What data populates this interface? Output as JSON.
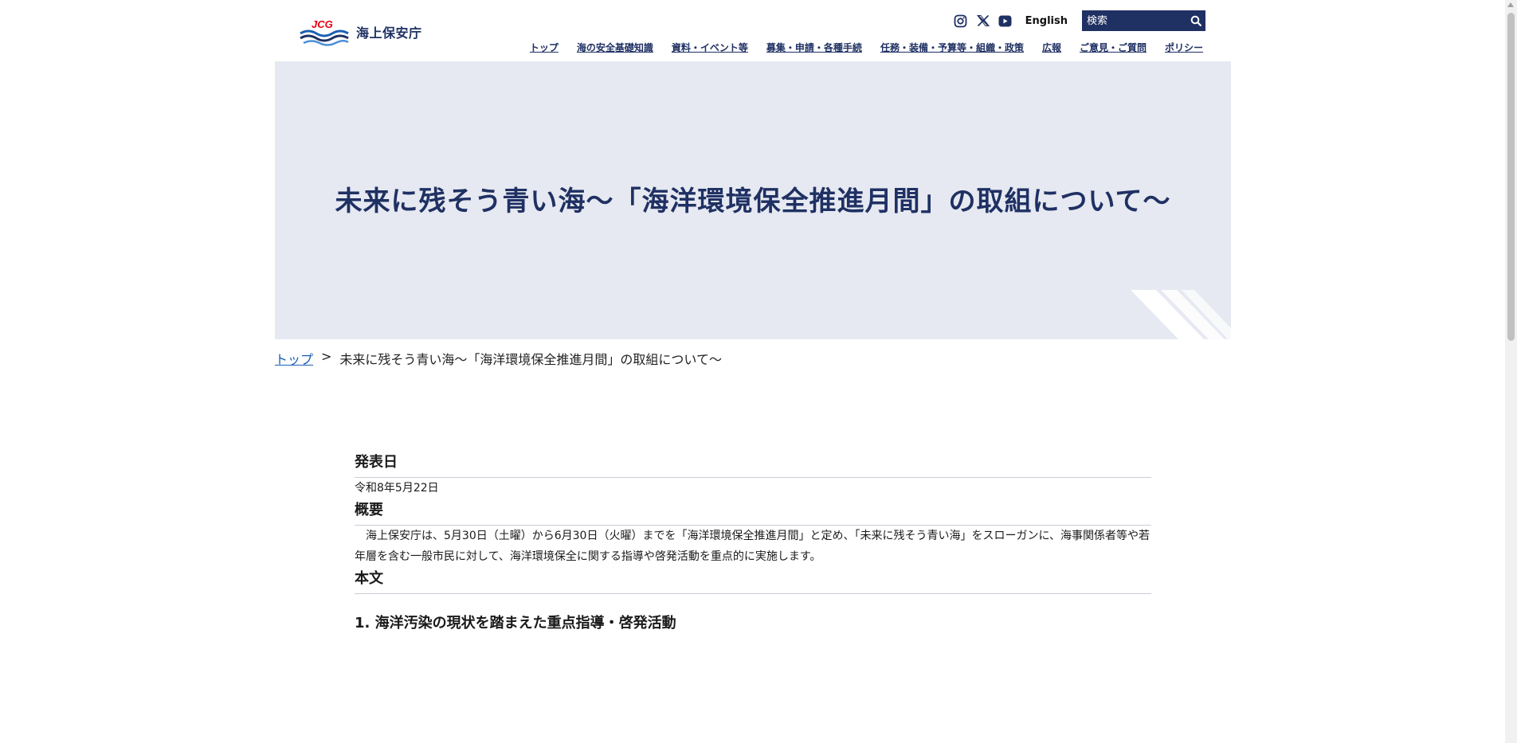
{
  "header": {
    "logo_mark": "JCG",
    "logo_name": "海上保安庁",
    "sns": [
      "instagram-icon",
      "x-icon",
      "youtube-icon"
    ],
    "english_label": "English",
    "search_placeholder": "検索",
    "nav": [
      {
        "label": "トップ"
      },
      {
        "label": "海の安全基礎知識"
      },
      {
        "label": "資料・イベント等"
      },
      {
        "label": "募集・申請・各種手続"
      },
      {
        "label": "任務・装備・予算等・組織・政策"
      },
      {
        "label": "広報"
      },
      {
        "label": "ご意見・ご質問"
      },
      {
        "label": "ポリシー"
      }
    ]
  },
  "hero": {
    "title": "未来に残そう青い海～「海洋環境保全推進月間」の取組について～"
  },
  "breadcrumb": {
    "home": "トップ",
    "separator": ">",
    "current": "未来に残そう青い海～「海洋環境保全推進月間」の取組について～"
  },
  "content": {
    "date_heading": "発表日",
    "date_value": "令和8年5月22日",
    "summary_heading": "概要",
    "summary_text": "海上保安庁は、5月30日（土曜）から6月30日（火曜）までを「海洋環境保全推進月間」と定め、「未来に残そう青い海」をスローガンに、海事関係者等や若年層を含む一般市民に対して、海洋環境保全に関する指導や啓発活動を重点的に実施します。",
    "body_heading": "本文",
    "section1_title": "1.  海洋汚染の現状を踏まえた重点指導・啓発活動"
  },
  "colors": {
    "brand_navy": "#1f3063",
    "hero_bg": "#e6e9f1",
    "link_blue": "#1a5fb4",
    "logo_red": "#e60012"
  }
}
